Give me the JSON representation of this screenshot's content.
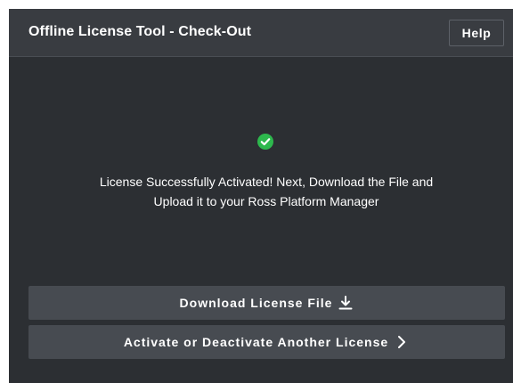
{
  "header": {
    "title": "Offline License Tool - Check-Out",
    "help_label": "Help"
  },
  "status": {
    "icon": "check-circle-icon",
    "color": "#2db84d",
    "message_line1": "License Successfully Activated! Next, Download the File and",
    "message_line2": "Upload it to your Ross Platform Manager"
  },
  "actions": {
    "download_label": "Download License File",
    "download_icon": "download-icon",
    "activate_label": "Activate or Deactivate Another License",
    "activate_icon": "chevron-right-icon"
  },
  "colors": {
    "panel_bg": "#2c2f33",
    "header_bg": "#393c41",
    "button_bg": "#474b51"
  }
}
